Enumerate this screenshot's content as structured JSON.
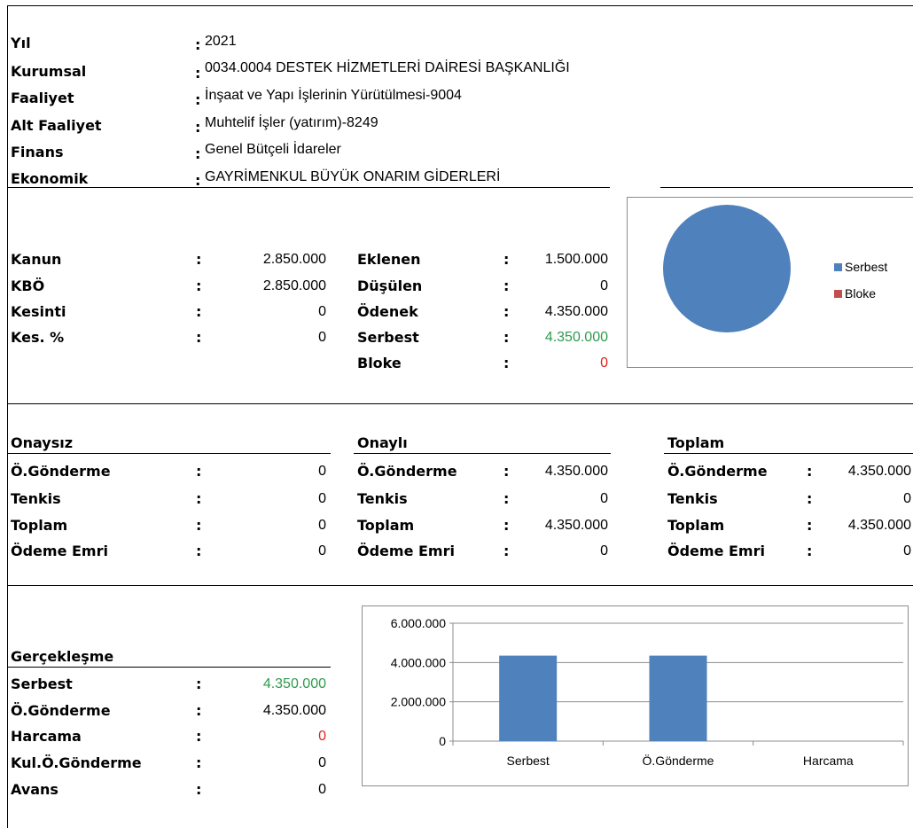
{
  "info": [
    {
      "label": "Yıl",
      "value": "2021"
    },
    {
      "label": "Kurumsal",
      "value": "0034.0004 DESTEK HİZMETLERİ DAİRESİ BAŞKANLIĞI"
    },
    {
      "label": "Faaliyet",
      "value": "İnşaat ve Yapı İşlerinin Yürütülmesi-9004"
    },
    {
      "label": "Alt Faaliyet",
      "value": "Muhtelif İşler (yatırım)-8249"
    },
    {
      "label": "Finans",
      "value": "Genel Bütçeli İdareler"
    },
    {
      "label": "Ekonomik",
      "value": "GAYRİMENKUL BÜYÜK ONARIM GİDERLERİ"
    }
  ],
  "colon": ":",
  "budget_left": [
    {
      "label": "Kanun",
      "value": "2.850.000"
    },
    {
      "label": "KBÖ",
      "value": "2.850.000"
    },
    {
      "label": "Kesinti",
      "value": "0"
    },
    {
      "label": "Kes. %",
      "value": "0"
    }
  ],
  "budget_right": [
    {
      "label": "Eklenen",
      "value": "1.500.000"
    },
    {
      "label": "Düşülen",
      "value": "0"
    },
    {
      "label": "Ödenek",
      "value": "4.350.000"
    },
    {
      "label": "Serbest",
      "value": "4.350.000"
    },
    {
      "label": "Bloke",
      "value": "0"
    }
  ],
  "colors": {
    "green": "#2e9a4e",
    "red": "#e0201b",
    "series_blue": "#4f81bd",
    "series_red": "#c0504d"
  },
  "onaysiz": {
    "title": "Onaysız",
    "rows": [
      {
        "label": "Ö.Gönderme",
        "value": "0"
      },
      {
        "label": "Tenkis",
        "value": "0"
      },
      {
        "label": "Toplam",
        "value": "0"
      },
      {
        "label": "Ödeme Emri",
        "value": "0"
      }
    ]
  },
  "onayli": {
    "title": "Onaylı",
    "rows": [
      {
        "label": "Ö.Gönderme",
        "value": "4.350.000"
      },
      {
        "label": "Tenkis",
        "value": "0"
      },
      {
        "label": "Toplam",
        "value": "4.350.000"
      },
      {
        "label": "Ödeme Emri",
        "value": "0"
      }
    ]
  },
  "toplam": {
    "title": "Toplam",
    "rows": [
      {
        "label": "Ö.Gönderme",
        "value": "4.350.000"
      },
      {
        "label": "Tenkis",
        "value": "0"
      },
      {
        "label": "Toplam",
        "value": "4.350.000"
      },
      {
        "label": "Ödeme Emri",
        "value": "0"
      }
    ]
  },
  "gerceklesme": {
    "title": "Gerçekleşme",
    "rows": [
      {
        "label": "Serbest",
        "value": "4.350.000"
      },
      {
        "label": "Ö.Gönderme",
        "value": "4.350.000"
      },
      {
        "label": "Harcama",
        "value": "0"
      },
      {
        "label": "Kul.Ö.Gönderme",
        "value": "0"
      },
      {
        "label": "Avans",
        "value": "0"
      }
    ]
  },
  "chart_data": [
    {
      "type": "pie",
      "categories": [
        "Serbest",
        "Bloke"
      ],
      "values": [
        4350000,
        0
      ],
      "legend_position": "right",
      "colors": [
        "#4f81bd",
        "#c0504d"
      ]
    },
    {
      "type": "bar",
      "categories": [
        "Serbest",
        "Ö.Gönderme",
        "Harcama"
      ],
      "values": [
        4350000,
        4350000,
        0
      ],
      "ylim": [
        0,
        6000000
      ],
      "yticks": [
        0,
        2000000,
        4000000,
        6000000
      ],
      "ytick_labels": [
        "0",
        "2.000.000",
        "4.000.000",
        "6.000.000"
      ],
      "grid": true,
      "legend": false,
      "color": "#4f81bd"
    }
  ]
}
